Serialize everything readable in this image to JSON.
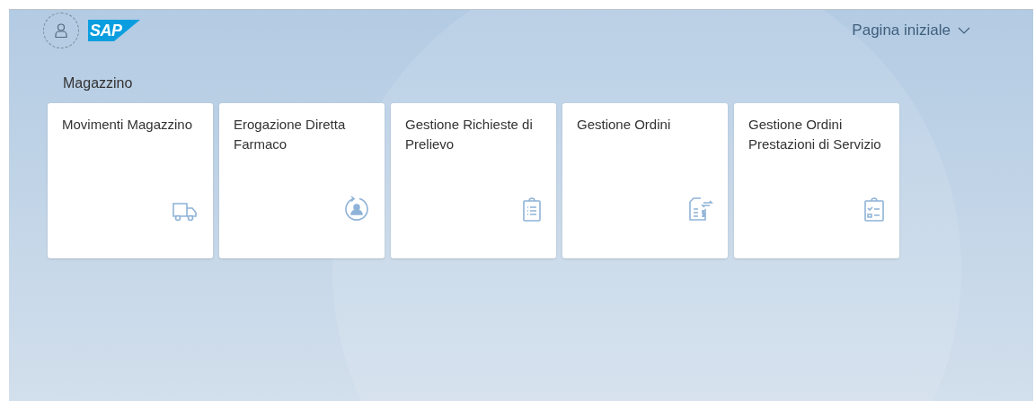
{
  "header": {
    "logo": "SAP",
    "title": "Pagina iniziale"
  },
  "group": {
    "title": "Magazzino",
    "tiles": [
      {
        "title": "Movimenti Magazzino",
        "kind": "truck"
      },
      {
        "title": "Erogazione Diretta Farmaco",
        "kind": "person-cycle"
      },
      {
        "title": "Gestione Richieste di Prelievo",
        "kind": "clipboard-list"
      },
      {
        "title": "Gestione Ordini",
        "kind": "invoice-exchange"
      },
      {
        "title": "Gestione Ordini Prestazioni di Servizio",
        "kind": "checklist"
      }
    ]
  }
}
